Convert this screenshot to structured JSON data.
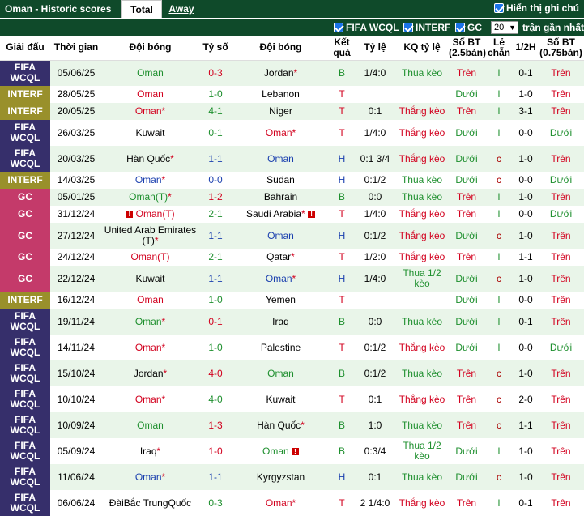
{
  "header": {
    "title": "Oman - Historic scores",
    "tab_total": "Total",
    "tab_away": "Away",
    "history_label": "Hiển thị ghi chú"
  },
  "filters": {
    "f1": "FIFA WCQL",
    "f2": "INTERF",
    "f3": "GC",
    "count": "20",
    "recent_label": "trận gần nhất"
  },
  "columns": {
    "league": "Giải đấu",
    "time": "Thời gian",
    "home": "Đội bóng",
    "score": "Tỷ số",
    "away": "Đội bóng",
    "result": "Kết quả",
    "odds": "Tỷ lệ",
    "kq_odds": "KQ tỷ lệ",
    "ou": "Số BT (2.5bàn)",
    "oe": "Lẻ chẵn",
    "half": "1/2H",
    "ou2": "Số BT (0.75bàn)"
  },
  "colors": {
    "fifa": "#362f6b",
    "interf": "#99902b",
    "gc": "#c43a6a",
    "header_bg": "#0f4a2a"
  },
  "rows": [
    {
      "league": "FIFA WCQL",
      "date": "05/06/25",
      "home": "Oman",
      "home_star": false,
      "home_flag": false,
      "score": "0-3",
      "away": "Jordan",
      "away_star": true,
      "away_flag": false,
      "res": "B",
      "odds": "1/4:0",
      "kq": "Thua kèo",
      "ou": "Trên",
      "oe": "l",
      "half": "0-1",
      "ou2": "Trên",
      "hc": "green",
      "ac": "black",
      "sc": "red"
    },
    {
      "league": "INTERF",
      "date": "28/05/25",
      "home": "Oman",
      "home_star": false,
      "home_flag": false,
      "score": "1-0",
      "away": "Lebanon",
      "away_star": false,
      "away_flag": false,
      "res": "T",
      "odds": "",
      "kq": "",
      "ou": "Dưới",
      "oe": "l",
      "half": "1-0",
      "ou2": "Trên",
      "hc": "red",
      "ac": "black",
      "sc": "green"
    },
    {
      "league": "INTERF",
      "date": "20/05/25",
      "home": "Oman",
      "home_star": true,
      "home_flag": false,
      "score": "4-1",
      "away": "Niger",
      "away_star": false,
      "away_flag": false,
      "res": "T",
      "odds": "0:1",
      "kq": "Thắng kèo",
      "ou": "Trên",
      "oe": "l",
      "half": "3-1",
      "ou2": "Trên",
      "hc": "red",
      "ac": "black",
      "sc": "green"
    },
    {
      "league": "FIFA WCQL",
      "date": "26/03/25",
      "home": "Kuwait",
      "home_star": false,
      "home_flag": false,
      "score": "0-1",
      "away": "Oman",
      "away_star": true,
      "away_flag": false,
      "res": "T",
      "odds": "1/4:0",
      "kq": "Thắng kèo",
      "ou": "Dưới",
      "oe": "l",
      "half": "0-0",
      "ou2": "Dưới",
      "hc": "black",
      "ac": "red",
      "sc": "green"
    },
    {
      "league": "FIFA WCQL",
      "date": "20/03/25",
      "home": "Hàn Quốc",
      "home_star": true,
      "home_flag": false,
      "score": "1-1",
      "away": "Oman",
      "away_star": false,
      "away_flag": false,
      "res": "H",
      "odds": "0:1 3/4",
      "kq": "Thắng kèo",
      "ou": "Dưới",
      "oe": "c",
      "half": "1-0",
      "ou2": "Trên",
      "hc": "black",
      "ac": "blue",
      "sc": "blue"
    },
    {
      "league": "INTERF",
      "date": "14/03/25",
      "home": "Oman",
      "home_star": true,
      "home_flag": false,
      "score": "0-0",
      "away": "Sudan",
      "away_star": false,
      "away_flag": false,
      "res": "H",
      "odds": "0:1/2",
      "kq": "Thua kèo",
      "ou": "Dưới",
      "oe": "c",
      "half": "0-0",
      "ou2": "Dưới",
      "hc": "blue",
      "ac": "black",
      "sc": "blue"
    },
    {
      "league": "GC",
      "date": "05/01/25",
      "home": "Oman(T)",
      "home_star": true,
      "home_flag": false,
      "score": "1-2",
      "away": "Bahrain",
      "away_star": false,
      "away_flag": false,
      "res": "B",
      "odds": "0:0",
      "kq": "Thua kèo",
      "ou": "Trên",
      "oe": "l",
      "half": "1-0",
      "ou2": "Trên",
      "hc": "green",
      "ac": "black",
      "sc": "red"
    },
    {
      "league": "GC",
      "date": "31/12/24",
      "home": "Oman(T)",
      "home_star": false,
      "home_flag": true,
      "score": "2-1",
      "away": "Saudi Arabia",
      "away_star": true,
      "away_flag": true,
      "res": "T",
      "odds": "1/4:0",
      "kq": "Thắng kèo",
      "ou": "Trên",
      "oe": "l",
      "half": "0-0",
      "ou2": "Dưới",
      "hc": "red",
      "ac": "black",
      "sc": "green"
    },
    {
      "league": "GC",
      "date": "27/12/24",
      "home": "United Arab Emirates (T)",
      "home_star": true,
      "home_flag": false,
      "score": "1-1",
      "away": "Oman",
      "away_star": false,
      "away_flag": false,
      "res": "H",
      "odds": "0:1/2",
      "kq": "Thắng kèo",
      "ou": "Dưới",
      "oe": "c",
      "half": "1-0",
      "ou2": "Trên",
      "hc": "black",
      "ac": "blue",
      "sc": "blue"
    },
    {
      "league": "GC",
      "date": "24/12/24",
      "home": "Oman(T)",
      "home_star": false,
      "home_flag": false,
      "score": "2-1",
      "away": "Qatar",
      "away_star": true,
      "away_flag": false,
      "res": "T",
      "odds": "1/2:0",
      "kq": "Thắng kèo",
      "ou": "Trên",
      "oe": "l",
      "half": "1-1",
      "ou2": "Trên",
      "hc": "red",
      "ac": "black",
      "sc": "green"
    },
    {
      "league": "GC",
      "date": "22/12/24",
      "home": "Kuwait",
      "home_star": false,
      "home_flag": false,
      "score": "1-1",
      "away": "Oman",
      "away_star": true,
      "away_flag": false,
      "res": "H",
      "odds": "1/4:0",
      "kq": "Thua 1/2 kèo",
      "ou": "Dưới",
      "oe": "c",
      "half": "1-0",
      "ou2": "Trên",
      "hc": "black",
      "ac": "blue",
      "sc": "blue"
    },
    {
      "league": "INTERF",
      "date": "16/12/24",
      "home": "Oman",
      "home_star": false,
      "home_flag": false,
      "score": "1-0",
      "away": "Yemen",
      "away_star": false,
      "away_flag": false,
      "res": "T",
      "odds": "",
      "kq": "",
      "ou": "Dưới",
      "oe": "l",
      "half": "0-0",
      "ou2": "Trên",
      "hc": "red",
      "ac": "black",
      "sc": "green"
    },
    {
      "league": "FIFA WCQL",
      "date": "19/11/24",
      "home": "Oman",
      "home_star": true,
      "home_flag": false,
      "score": "0-1",
      "away": "Iraq",
      "away_star": false,
      "away_flag": false,
      "res": "B",
      "odds": "0:0",
      "kq": "Thua kèo",
      "ou": "Dưới",
      "oe": "l",
      "half": "0-1",
      "ou2": "Trên",
      "hc": "green",
      "ac": "black",
      "sc": "red"
    },
    {
      "league": "FIFA WCQL",
      "date": "14/11/24",
      "home": "Oman",
      "home_star": true,
      "home_flag": false,
      "score": "1-0",
      "away": "Palestine",
      "away_star": false,
      "away_flag": false,
      "res": "T",
      "odds": "0:1/2",
      "kq": "Thắng kèo",
      "ou": "Dưới",
      "oe": "l",
      "half": "0-0",
      "ou2": "Dưới",
      "hc": "red",
      "ac": "black",
      "sc": "green"
    },
    {
      "league": "FIFA WCQL",
      "date": "15/10/24",
      "home": "Jordan",
      "home_star": true,
      "home_flag": false,
      "score": "4-0",
      "away": "Oman",
      "away_star": false,
      "away_flag": false,
      "res": "B",
      "odds": "0:1/2",
      "kq": "Thua kèo",
      "ou": "Trên",
      "oe": "c",
      "half": "1-0",
      "ou2": "Trên",
      "hc": "black",
      "ac": "green",
      "sc": "red"
    },
    {
      "league": "FIFA WCQL",
      "date": "10/10/24",
      "home": "Oman",
      "home_star": true,
      "home_flag": false,
      "score": "4-0",
      "away": "Kuwait",
      "away_star": false,
      "away_flag": false,
      "res": "T",
      "odds": "0:1",
      "kq": "Thắng kèo",
      "ou": "Trên",
      "oe": "c",
      "half": "2-0",
      "ou2": "Trên",
      "hc": "red",
      "ac": "black",
      "sc": "green"
    },
    {
      "league": "FIFA WCQL",
      "date": "10/09/24",
      "home": "Oman",
      "home_star": false,
      "home_flag": false,
      "score": "1-3",
      "away": "Hàn Quốc",
      "away_star": true,
      "away_flag": false,
      "res": "B",
      "odds": "1:0",
      "kq": "Thua kèo",
      "ou": "Trên",
      "oe": "c",
      "half": "1-1",
      "ou2": "Trên",
      "hc": "green",
      "ac": "black",
      "sc": "red"
    },
    {
      "league": "FIFA WCQL",
      "date": "05/09/24",
      "home": "Iraq",
      "home_star": true,
      "home_flag": false,
      "score": "1-0",
      "away": "Oman",
      "away_star": false,
      "away_flag": true,
      "res": "B",
      "odds": "0:3/4",
      "kq": "Thua 1/2 kèo",
      "ou": "Dưới",
      "oe": "l",
      "half": "1-0",
      "ou2": "Trên",
      "hc": "black",
      "ac": "green",
      "sc": "red"
    },
    {
      "league": "FIFA WCQL",
      "date": "11/06/24",
      "home": "Oman",
      "home_star": true,
      "home_flag": false,
      "score": "1-1",
      "away": "Kyrgyzstan",
      "away_star": false,
      "away_flag": false,
      "res": "H",
      "odds": "0:1",
      "kq": "Thua kèo",
      "ou": "Dưới",
      "oe": "c",
      "half": "1-0",
      "ou2": "Trên",
      "hc": "blue",
      "ac": "black",
      "sc": "blue"
    },
    {
      "league": "FIFA WCQL",
      "date": "06/06/24",
      "home": "ĐàiBắc TrungQuốc",
      "home_star": false,
      "home_flag": false,
      "score": "0-3",
      "away": "Oman",
      "away_star": true,
      "away_flag": false,
      "res": "T",
      "odds": "2 1/4:0",
      "kq": "Thắng kèo",
      "ou": "Trên",
      "oe": "l",
      "half": "0-1",
      "ou2": "Trên",
      "hc": "black",
      "ac": "red",
      "sc": "green"
    }
  ]
}
